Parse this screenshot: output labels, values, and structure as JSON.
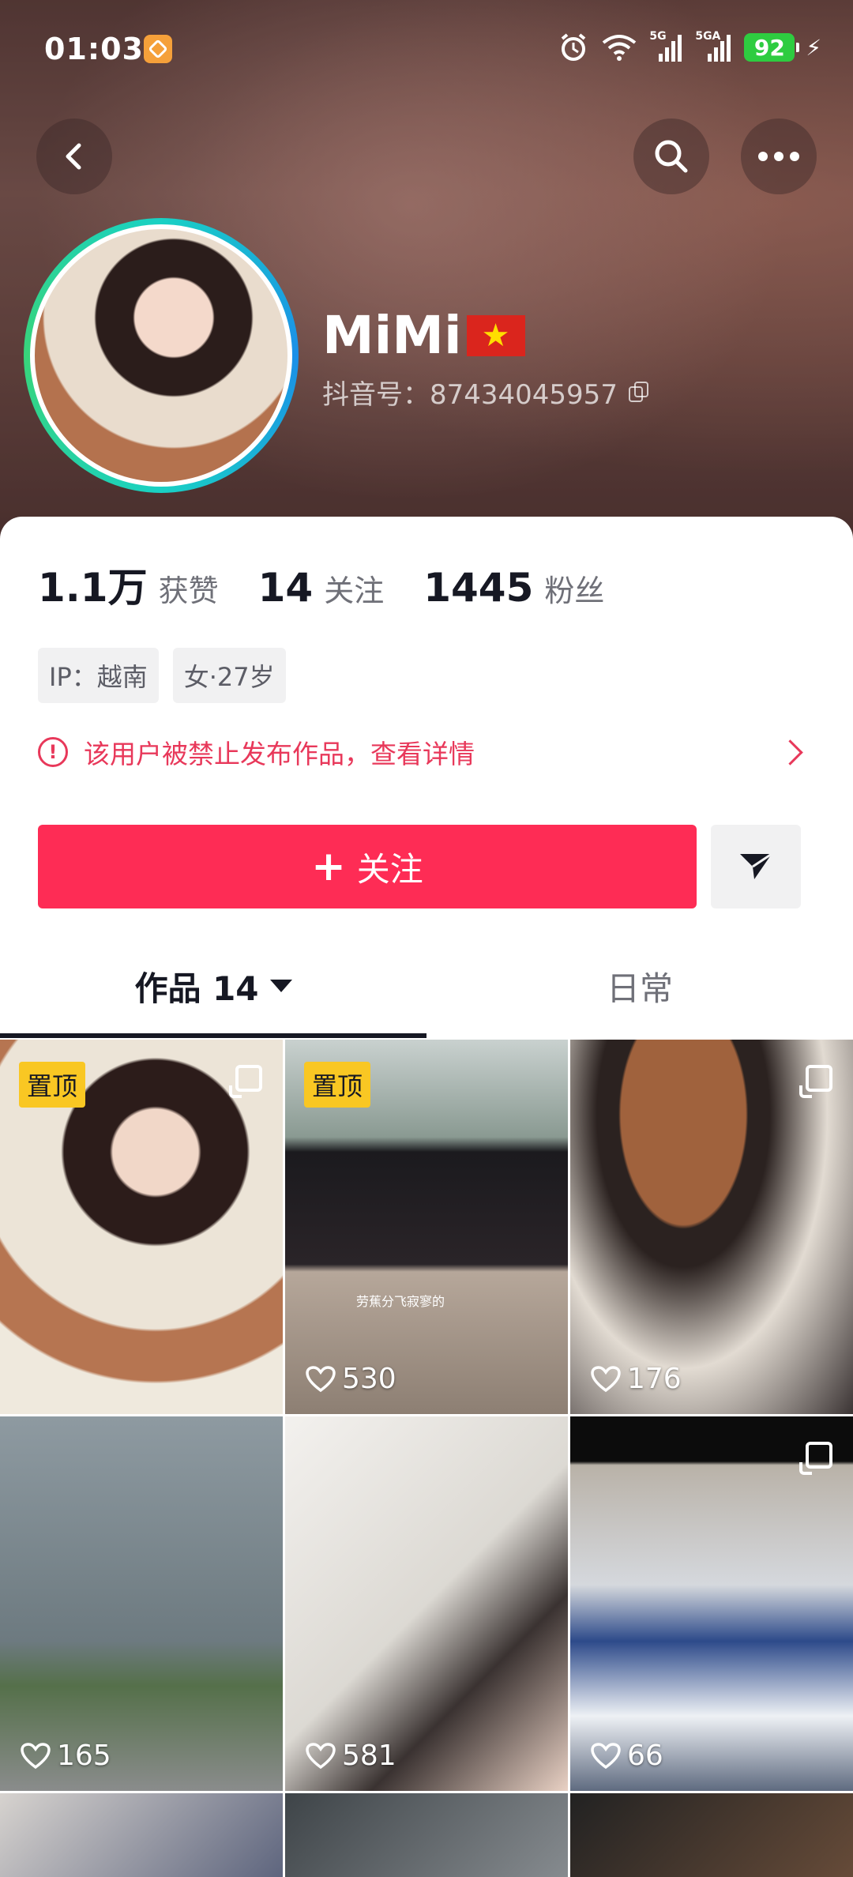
{
  "status_bar": {
    "time": "01:03",
    "network_1": "5G",
    "network_2": "5GA",
    "battery": "92"
  },
  "profile": {
    "name": "MiMi",
    "flag": "🇻🇳",
    "douyin_id_label": "抖音号：",
    "douyin_id": "87434045957"
  },
  "stats": [
    {
      "value": "1.1万",
      "label": "获赞"
    },
    {
      "value": "14",
      "label": "关注"
    },
    {
      "value": "1445",
      "label": "粉丝"
    }
  ],
  "tags": [
    "IP：越南",
    "女·27岁"
  ],
  "warning": {
    "text": "该用户被禁止发布作品，查看详情"
  },
  "actions": {
    "follow_label": "关注",
    "follow_plus": "+"
  },
  "tabs": [
    {
      "label": "作品 14"
    },
    {
      "label": "日常"
    }
  ],
  "grid": [
    {
      "pinned_label": "置顶",
      "likes": ""
    },
    {
      "pinned_label": "置顶",
      "likes": "530",
      "caption": "劳蕉分飞寂寥的"
    },
    {
      "likes": "176"
    },
    {
      "likes": "165"
    },
    {
      "likes": "581"
    },
    {
      "likes": "66"
    }
  ],
  "colors": {
    "accent": "#fe2c55",
    "warning": "#e8385a",
    "pin": "#f9c723"
  }
}
